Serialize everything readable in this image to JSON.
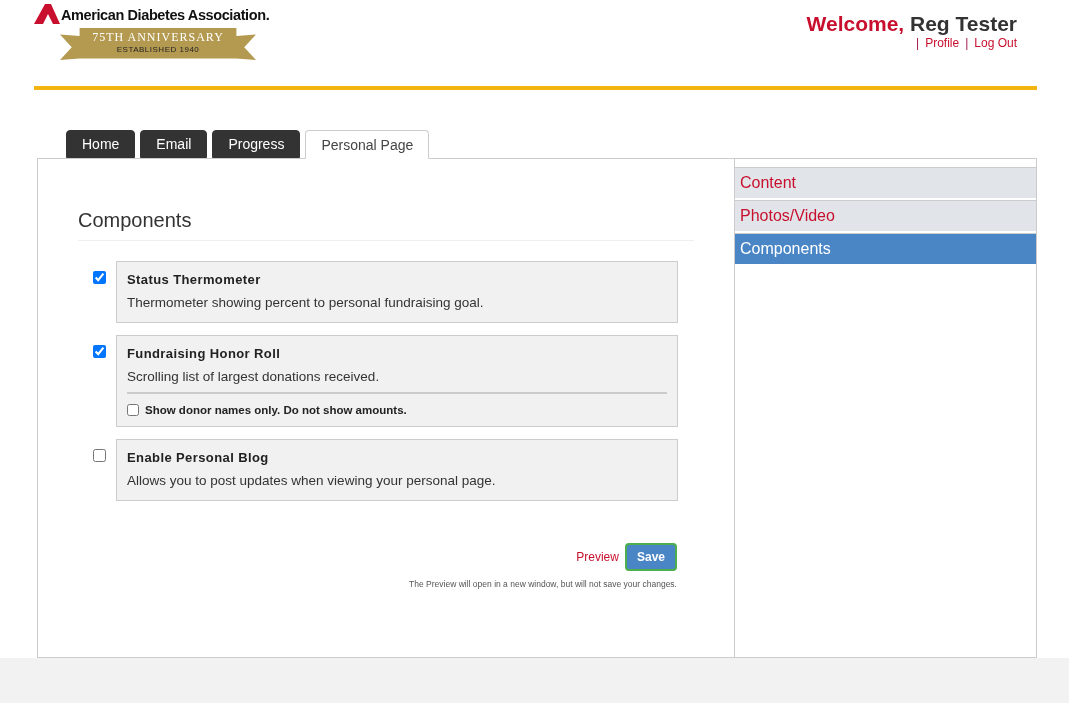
{
  "logo": {
    "name": "American Diabetes Association.",
    "banner": "75TH ANNIVERSARY",
    "established": "ESTABLISHED 1940"
  },
  "user": {
    "greeting": "Welcome,",
    "name": "Reg Tester",
    "links": [
      {
        "separator": "|",
        "label": "Profile"
      },
      {
        "separator": "|",
        "label": "Log Out"
      }
    ]
  },
  "tabs": [
    {
      "label": "Home",
      "selected": false
    },
    {
      "label": "Email",
      "selected": false
    },
    {
      "label": "Progress",
      "selected": false
    },
    {
      "label": "Personal Page",
      "selected": true
    }
  ],
  "section_title": "Components",
  "components": [
    {
      "title": "Status Thermometer",
      "description": "Thermometer showing percent to personal fundraising goal.",
      "checked": true
    },
    {
      "title": "Fundraising Honor Roll",
      "description": "Scrolling list of largest donations received.",
      "checked": true,
      "option": {
        "label": "Show donor names only. Do not show amounts.",
        "checked": false
      }
    },
    {
      "title": "Enable Personal Blog",
      "description": "Allows you to post updates when viewing your personal page.",
      "checked": false
    }
  ],
  "actions": {
    "preview": "Preview",
    "save": "Save",
    "note": "The Preview will open in a new window, but will not save your changes."
  },
  "sidebar": {
    "items": [
      {
        "label": "Content",
        "selected": false
      },
      {
        "label": "Photos/Video",
        "selected": false
      },
      {
        "label": "Components",
        "selected": true
      }
    ]
  }
}
